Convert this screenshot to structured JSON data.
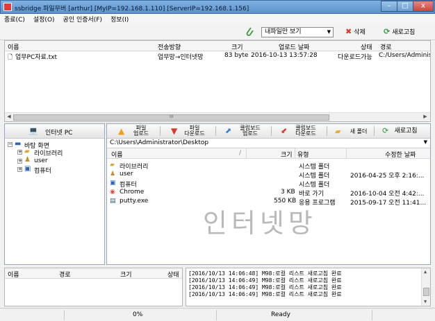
{
  "window": {
    "title": "ssbridge 파일무버 [arthur] [MyIP=192.168.1.110] [ServerIP=192.168.1.156]",
    "minimize": "–",
    "maximize": "□",
    "close": "x"
  },
  "menu": {
    "items": [
      "종료(C)",
      "설정(O)",
      "공인 인증서(F)",
      "정보(I)"
    ]
  },
  "toolbar": {
    "filter_value": "내파일만 보기",
    "delete_label": "삭제",
    "refresh_label": "새로고침"
  },
  "transfer_list": {
    "columns": [
      "이름",
      "전송방향",
      "크기",
      "업로드 날짜",
      "상태",
      "경로"
    ],
    "rows": [
      {
        "name": "업무PC자료.txt",
        "direction": "업무망→인터넷망",
        "size": "83 byte",
        "date": "2016-10-13 13:57:28",
        "status": "다운로드가능",
        "path": "C:/Users/Administrat"
      }
    ],
    "scroll_grip": "III"
  },
  "left_panel": {
    "title": "인터넷 PC",
    "tree": [
      {
        "label": "바탕 화면",
        "expander": "⊟"
      },
      {
        "label": "라이브러리",
        "expander": "⊞"
      },
      {
        "label": "user",
        "expander": "⊞"
      },
      {
        "label": "컴퓨터",
        "expander": "⊞"
      }
    ]
  },
  "right_toolbar": {
    "upload": [
      "파일",
      "업로드"
    ],
    "download": [
      "파일",
      "다운로드"
    ],
    "clip_upload": [
      "클립보드",
      "업로드"
    ],
    "clip_download": [
      "클립보드",
      "다운로드"
    ],
    "new_folder": "새 폴더",
    "refresh": "새로고침"
  },
  "file_browser": {
    "path": "C:\\Users\\Administrator\\Desktop",
    "columns": [
      "이름",
      "크기",
      "유형",
      "수정한 날짜"
    ],
    "sort_indicator": "/",
    "rows": [
      {
        "name": "라이브러리",
        "size": "",
        "type": "시스템 폴더",
        "date": ""
      },
      {
        "name": "user",
        "size": "",
        "type": "시스템 폴더",
        "date": "2016-04-25 오후 2:16:..."
      },
      {
        "name": "컴퓨터",
        "size": "",
        "type": "시스템 폴더",
        "date": ""
      },
      {
        "name": "Chrome",
        "size": "3 KB",
        "type": "바로 가기",
        "date": "2016-10-04 오전 4:42:..."
      },
      {
        "name": "putty.exe",
        "size": "550 KB",
        "type": "응용 프로그램",
        "date": "2015-09-17 오전 11:41..."
      }
    ],
    "watermark": "인터넷망"
  },
  "queue": {
    "columns": [
      "이름",
      "경로",
      "크기",
      "상태"
    ]
  },
  "log": {
    "lines": [
      "[2016/10/13 14:06:48] M98:로컬 리스트 새로고침 완료",
      "[2016/10/13 14:06:49] M98:로컬 리스트 새로고침 완료",
      "[2016/10/13 14:06:49] M98:로컬 리스트 새로고침 완료",
      "[2016/10/13 14:06:49] M98:로컬 리스트 새로고침 완료"
    ]
  },
  "status": {
    "progress": "0%",
    "state": "Ready"
  },
  "colors": {
    "titlebar": "#6a9fd6",
    "close_button": "#c8463a",
    "delete_icon": "#d93a2b",
    "refresh_icon": "#2f9a3a",
    "clip_icon": "#3aa03a"
  }
}
